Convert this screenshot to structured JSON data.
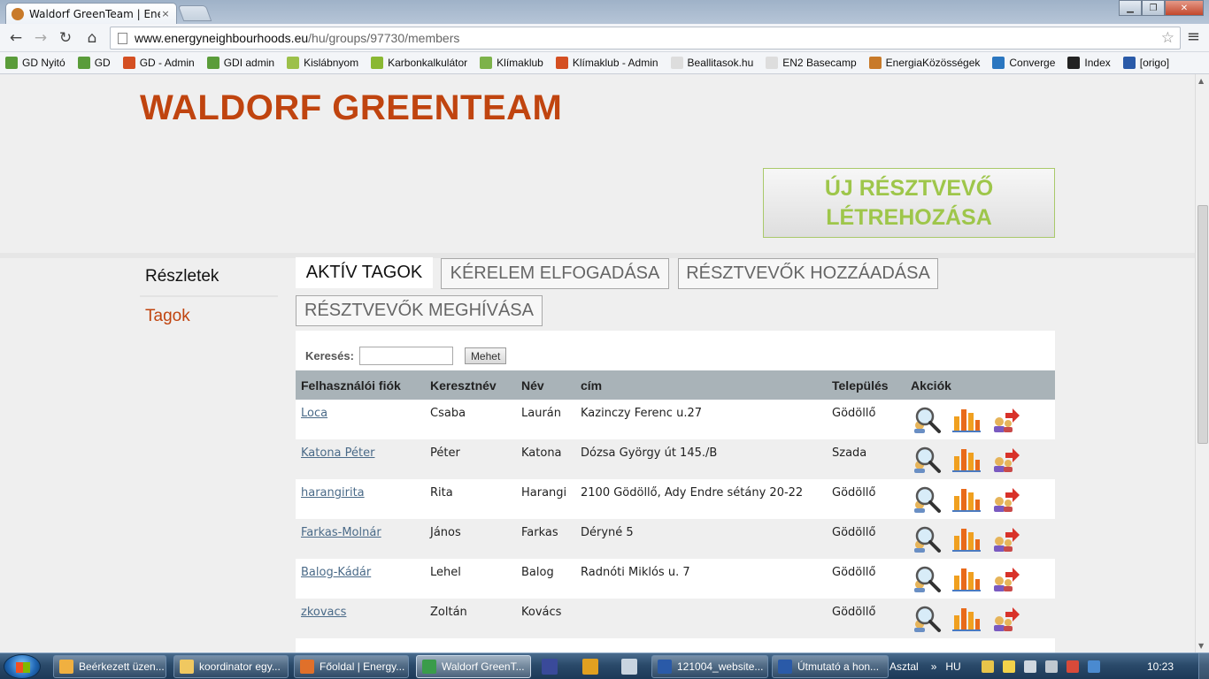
{
  "browser": {
    "tab_title": "Waldorf GreenTeam | Energ",
    "tab_close": "×",
    "url_host": "www.energyneighbourhoods.eu",
    "url_path": "/hu/groups/97730/members",
    "bookmarks": [
      {
        "label": "GD Nyitó",
        "color": "#5a9c3a"
      },
      {
        "label": "GD",
        "color": "#5a9c3a"
      },
      {
        "label": "GD - Admin",
        "color": "#d44f22"
      },
      {
        "label": "GDI admin",
        "color": "#5a9c3a"
      },
      {
        "label": "Kislábnyom",
        "color": "#9cc04a"
      },
      {
        "label": "Karbonkalkulátor",
        "color": "#8ab832"
      },
      {
        "label": "Klímaklub",
        "color": "#7db24a"
      },
      {
        "label": "Klímaklub - Admin",
        "color": "#d44f22"
      },
      {
        "label": "Beallitasok.hu",
        "color": "#dddddd"
      },
      {
        "label": "EN2 Basecamp",
        "color": "#dddddd"
      },
      {
        "label": "EnergiaKözösségek",
        "color": "#c87a2a"
      },
      {
        "label": "Converge",
        "color": "#2a76c0"
      },
      {
        "label": "Index",
        "color": "#222222"
      },
      {
        "label": "[origo]",
        "color": "#2a5aa8"
      }
    ]
  },
  "page": {
    "group_title": "WALDORF GREENTEAM",
    "new_participant_button": "ÚJ RÉSZTVEVŐ LÉTREHOZÁSA",
    "sidebar": [
      {
        "label": "Részletek",
        "active": false
      },
      {
        "label": "Tagok",
        "active": true
      }
    ],
    "tabs": [
      {
        "label": "AKTÍV TAGOK",
        "active": true
      },
      {
        "label": "KÉRELEM ELFOGADÁSA",
        "active": false
      },
      {
        "label": "RÉSZTVEVŐK HOZZÁADÁSA",
        "active": false
      },
      {
        "label": "RÉSZTVEVŐK MEGHÍVÁSA",
        "active": false
      }
    ],
    "search": {
      "label": "Keresés:",
      "value": "",
      "button": "Mehet"
    },
    "table": {
      "headers": [
        "Felhasználói fiók",
        "Keresztnév",
        "Név",
        "cím",
        "Település",
        "Akciók"
      ],
      "rows": [
        {
          "account": "Loca",
          "first_name": "Csaba",
          "last_name": "Laurán",
          "address": "Kazinczy Ferenc u.27",
          "town": "Gödöllő"
        },
        {
          "account": "Katona Péter",
          "first_name": "Péter",
          "last_name": "Katona",
          "address": "Dózsa György út 145./B",
          "town": "Szada"
        },
        {
          "account": "harangirita",
          "first_name": "Rita",
          "last_name": "Harangi",
          "address": "2100 Gödöllő, Ady Endre sétány 20-22",
          "town": "Gödöllő"
        },
        {
          "account": "Farkas-Molnár",
          "first_name": "János",
          "last_name": "Farkas",
          "address": "Déryné 5",
          "town": "Gödöllő"
        },
        {
          "account": "Balog-Kádár",
          "first_name": "Lehel",
          "last_name": "Balog",
          "address": "Radnóti Miklós u. 7",
          "town": "Gödöllő"
        },
        {
          "account": "zkovacs",
          "first_name": "Zoltán",
          "last_name": "Kovács",
          "address": "",
          "town": "Gödöllő"
        }
      ],
      "action_icons": [
        "view-user-icon",
        "statistics-icon",
        "transfer-user-icon"
      ]
    }
  },
  "taskbar": {
    "items": [
      {
        "label": "Beérkezett üzen...",
        "color": "#f0b040",
        "active": false
      },
      {
        "label": "koordinator egy...",
        "color": "#f0c860",
        "active": false
      },
      {
        "label": "Főoldal | Energy...",
        "color": "#e0702a",
        "active": false
      },
      {
        "label": "Waldorf GreenT...",
        "color": "#3a9c4a",
        "active": true
      },
      {
        "label": "121004_website...",
        "color": "#2a5aa8",
        "active": false
      },
      {
        "label": "Útmutató a hon...",
        "color": "#2a5aa8",
        "active": false
      }
    ],
    "desktop_label": "Asztal",
    "language": "HU",
    "clock": "10:23"
  },
  "colors": {
    "title_orange": "#c0440f",
    "button_green": "#9ec64a",
    "table_header": "#a9b3b8",
    "link": "#4a6a88"
  }
}
